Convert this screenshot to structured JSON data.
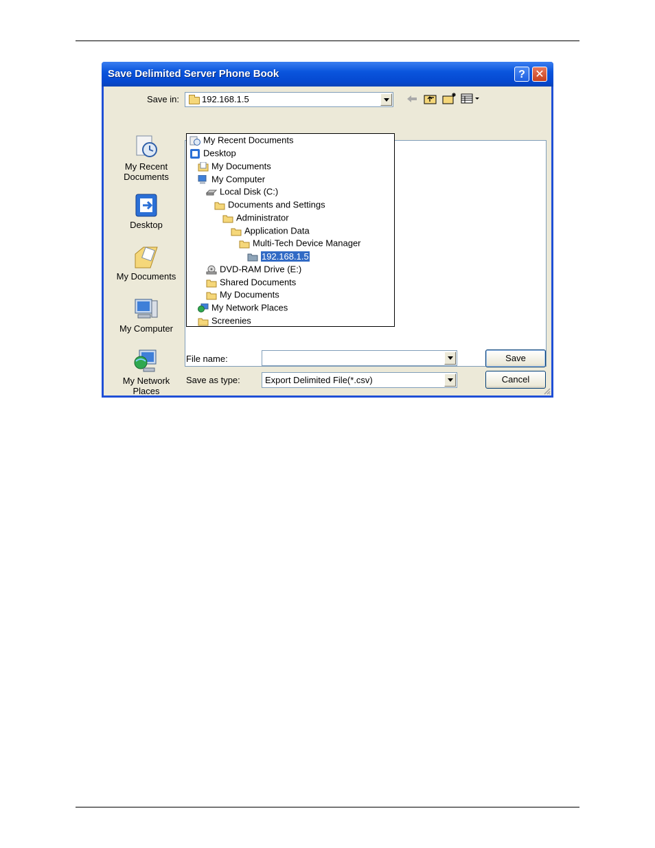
{
  "dialog": {
    "title": "Save Delimited Server Phone Book",
    "help_label": "?",
    "close_label": "✕"
  },
  "save_in": {
    "label": "Save in:",
    "value": "192.168.1.5"
  },
  "toolbar": {
    "back_icon": "back-arrow-icon",
    "up_icon": "up-folder-icon",
    "new_folder_icon": "new-folder-icon",
    "views_icon": "views-menu-icon"
  },
  "places": [
    {
      "label": "My Recent\nDocuments",
      "icon": "recent-documents-icon"
    },
    {
      "label": "Desktop",
      "icon": "desktop-icon"
    },
    {
      "label": "My Documents",
      "icon": "my-documents-icon"
    },
    {
      "label": "My Computer",
      "icon": "my-computer-icon"
    },
    {
      "label": "My Network\nPlaces",
      "icon": "network-places-icon"
    }
  ],
  "dropdown_items": [
    {
      "label": "My Recent Documents",
      "icon": "recent-documents-icon"
    },
    {
      "label": "Desktop",
      "icon": "desktop-icon"
    },
    {
      "label": "My Documents",
      "icon": "my-documents-icon"
    },
    {
      "label": "My Computer",
      "icon": "my-computer-icon"
    },
    {
      "label": "Local Disk (C:)",
      "icon": "hard-disk-icon"
    },
    {
      "label": "Documents and Settings",
      "icon": "folder-icon"
    },
    {
      "label": "Administrator",
      "icon": "folder-icon"
    },
    {
      "label": "Application Data",
      "icon": "folder-icon"
    },
    {
      "label": "Multi-Tech Device Manager",
      "icon": "folder-icon"
    },
    {
      "label": "192.168.1.5",
      "icon": "folder-icon",
      "selected": true
    },
    {
      "label": "DVD-RAM Drive (E:)",
      "icon": "dvd-drive-icon"
    },
    {
      "label": "Shared Documents",
      "icon": "folder-icon"
    },
    {
      "label": "My Documents",
      "icon": "folder-icon"
    },
    {
      "label": "My Network Places",
      "icon": "network-places-icon"
    },
    {
      "label": "Screenies",
      "icon": "folder-icon"
    }
  ],
  "file_name": {
    "label": "File name:",
    "value": ""
  },
  "save_as_type": {
    "label": "Save as type:",
    "value": "Export Delimited File(*.csv)"
  },
  "buttons": {
    "save": "Save",
    "cancel": "Cancel"
  },
  "colors": {
    "title_bar": "#0a55dd",
    "dialog_face": "#ece9d8",
    "selection": "#316ac5"
  }
}
